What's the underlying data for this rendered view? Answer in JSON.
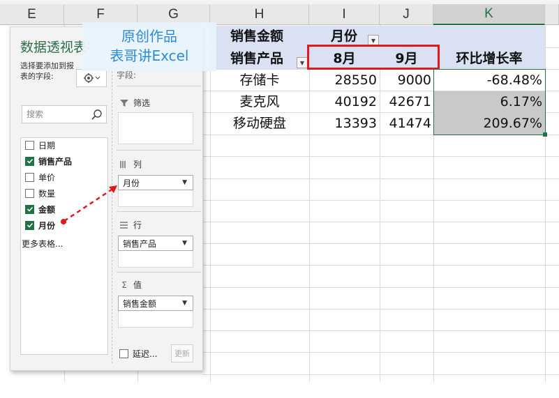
{
  "columns": [
    {
      "letter": "E"
    },
    {
      "letter": "F"
    },
    {
      "letter": "G"
    },
    {
      "letter": "H"
    },
    {
      "letter": "I"
    },
    {
      "letter": "J"
    },
    {
      "letter": "K"
    }
  ],
  "pivot": {
    "value_header": "销售金额",
    "column_field": "月份",
    "row_field": "销售产品",
    "months": [
      "8月",
      "9月"
    ],
    "growth_header": "环比增长率",
    "rows": [
      {
        "product": "存储卡",
        "aug": "28550",
        "sep": "9000",
        "growth": "-68.48%"
      },
      {
        "product": "麦克风",
        "aug": "40192",
        "sep": "42671",
        "growth": "6.17%"
      },
      {
        "product": "移动硬盘",
        "aug": "13393",
        "sep": "41474",
        "growth": "209.67%"
      }
    ]
  },
  "pane": {
    "title": "数据透视表字段",
    "instruction": "选择要添加到报表的字段:",
    "search_placeholder": "搜索",
    "fields": [
      {
        "label": "日期",
        "checked": false
      },
      {
        "label": "销售产品",
        "checked": true
      },
      {
        "label": "单价",
        "checked": false
      },
      {
        "label": "数量",
        "checked": false
      },
      {
        "label": "金额",
        "checked": true
      },
      {
        "label": "月份",
        "checked": true
      }
    ],
    "more_tables": "更多表格...",
    "areas": {
      "filter_label": "筛选",
      "column_label": "列",
      "column_chip": "月份",
      "row_label": "行",
      "row_chip": "销售产品",
      "value_label": "值",
      "value_chip": "销售金额",
      "partial_label": "字段:"
    },
    "defer_label": "延迟...",
    "update_label": "更新"
  },
  "watermark": {
    "line1": "原创作品",
    "line2": "表哥讲Excel"
  },
  "colors": {
    "excel_green": "#217346",
    "pivot_header_fill": "#d9e1f2",
    "highlight_red": "#e01919",
    "watermark_blue": "#2e8bd6"
  }
}
